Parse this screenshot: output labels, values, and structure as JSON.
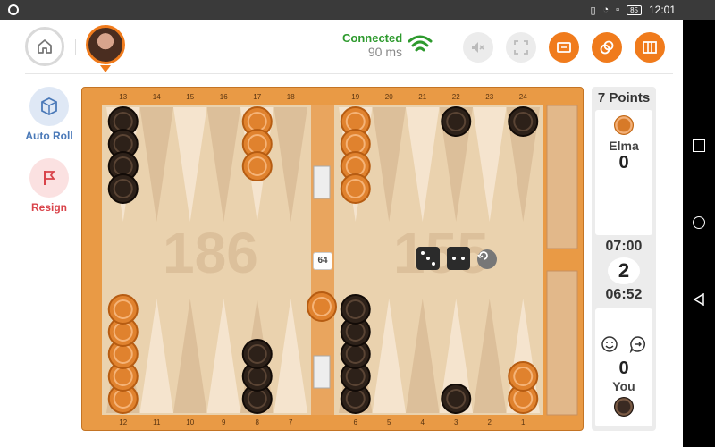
{
  "status_bar": {
    "battery": "85",
    "time": "12:01"
  },
  "header": {
    "connection_status": "Connected",
    "ping": "90 ms"
  },
  "sidebar": {
    "auto_roll_label": "Auto Roll",
    "resign_label": "Resign"
  },
  "board": {
    "top_point_numbers": [
      "13",
      "14",
      "15",
      "16",
      "17",
      "18",
      "19",
      "20",
      "21",
      "22",
      "23",
      "24"
    ],
    "bottom_point_numbers": [
      "12",
      "11",
      "10",
      "9",
      "8",
      "7",
      "6",
      "5",
      "4",
      "3",
      "2",
      "1"
    ],
    "opponent_pip_count": "186",
    "player_pip_count": "155",
    "doubling_cube": "64",
    "dice": [
      3,
      2
    ],
    "checker_colors": {
      "orange": "#e0822e",
      "dark": "#2d2119"
    }
  },
  "score_panel": {
    "match_points": "7 Points",
    "opponent": {
      "name": "Elma",
      "score": "0",
      "clock": "07:00"
    },
    "current_game": "2",
    "player": {
      "name": "You",
      "score": "0",
      "clock": "06:52"
    }
  },
  "colors": {
    "accent": "#f07b1c",
    "connected": "#2e9a2e",
    "resign": "#d9434a",
    "autoroll": "#4a79b8"
  }
}
